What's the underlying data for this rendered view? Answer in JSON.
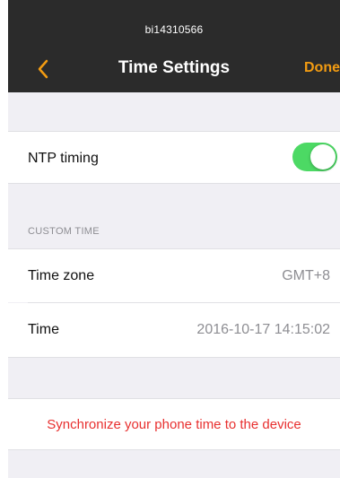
{
  "navbar": {
    "device_id": "bi14310566",
    "title": "Time Settings",
    "done_label": "Done"
  },
  "ntp": {
    "label": "NTP timing",
    "enabled": true
  },
  "custom_time": {
    "header": "CUSTOM TIME",
    "time_zone_label": "Time zone",
    "time_zone_value": "GMT+8",
    "time_label": "Time",
    "time_value": "2016-10-17 14:15:02"
  },
  "sync": {
    "label": "Synchronize your phone time to the device"
  },
  "colors": {
    "accent": "#f39c12",
    "toggle_on": "#4cd964",
    "danger": "#e8302f",
    "navbar_bg": "#2b2b2b"
  },
  "icons": {
    "back": "chevron-left-icon"
  }
}
